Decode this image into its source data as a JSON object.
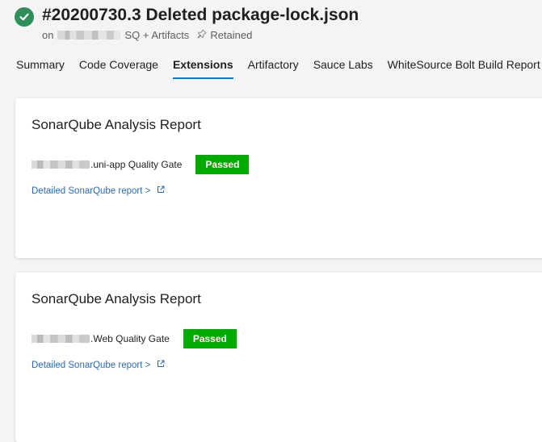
{
  "build": {
    "title": "#20200730.3 Deleted package-lock.json",
    "subtitle_prefix": "on",
    "subtitle_suffix": "SQ + Artifacts",
    "retained_label": "Retained",
    "status_color": "#2f8f5b",
    "status_icon": "check-icon"
  },
  "tabs": [
    {
      "label": "Summary",
      "active": false
    },
    {
      "label": "Code Coverage",
      "active": false
    },
    {
      "label": "Extensions",
      "active": true
    },
    {
      "label": "Artifactory",
      "active": false
    },
    {
      "label": "Sauce Labs",
      "active": false
    },
    {
      "label": "WhiteSource Bolt Build Report",
      "active": false
    }
  ],
  "reports": [
    {
      "title": "SonarQube Analysis Report",
      "gate_label": ".uni-app Quality Gate",
      "status": "Passed",
      "link_label": "Detailed SonarQube report >"
    },
    {
      "title": "SonarQube Analysis Report",
      "gate_label": ".Web Quality Gate",
      "status": "Passed",
      "link_label": "Detailed SonarQube report >"
    }
  ],
  "colors": {
    "passed": "#00aa00",
    "link": "#2b6cb0",
    "active_tab_underline": "#0078d4"
  }
}
